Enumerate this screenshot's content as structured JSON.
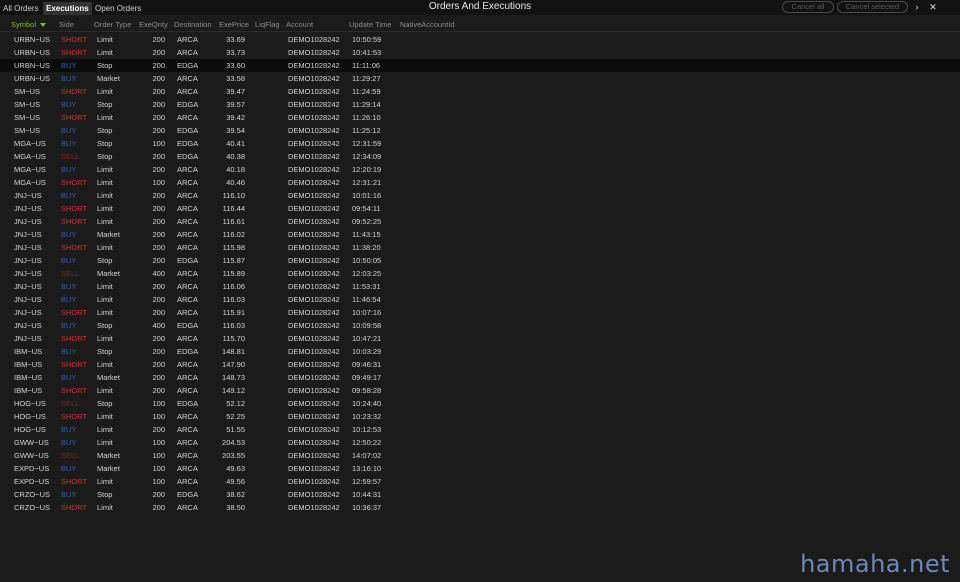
{
  "window": {
    "title": "Orders And Executions"
  },
  "tabs": [
    {
      "label": "All Orders",
      "active": false
    },
    {
      "label": "Executions",
      "active": true
    },
    {
      "label": "Open Orders",
      "active": false
    }
  ],
  "toolbar": {
    "cancel_all_label": "Cancel all",
    "cancel_selected_label": "Cancel selected",
    "expand_icon": "chevron-right-icon",
    "close_icon": "close-icon"
  },
  "columns": {
    "symbol": "Symbol",
    "side": "Side",
    "order_type": "Order Type",
    "exe_qnty": "ExeQnty",
    "destination": "Destination",
    "exe_price": "ExePrice",
    "liq_flag": "LiqFlag",
    "account": "Account",
    "update_time": "Update Time",
    "native_account_id": "NativeAccountId"
  },
  "sorted_column": "symbol",
  "colors": {
    "short": "#d23030",
    "buy": "#2f5fa8",
    "sell": "#8a2222",
    "accent": "#7fbf2a"
  },
  "rows": [
    {
      "symbol": "URBN~US",
      "side": "SHORT",
      "type": "Limit",
      "qty": "200",
      "dest": "ARCA",
      "price": "33.69",
      "account": "DEMO1028242",
      "time": "10:50:59"
    },
    {
      "symbol": "URBN~US",
      "side": "SHORT",
      "type": "Limit",
      "qty": "200",
      "dest": "ARCA",
      "price": "33.73",
      "account": "DEMO1028242",
      "time": "10:41:53"
    },
    {
      "symbol": "URBN~US",
      "side": "BUY",
      "type": "Stop",
      "qty": "200",
      "dest": "EDGA",
      "price": "33.60",
      "account": "DEMO1028242",
      "time": "11:11:06",
      "selected": true
    },
    {
      "symbol": "URBN~US",
      "side": "BUY",
      "type": "Market",
      "qty": "200",
      "dest": "ARCA",
      "price": "33.58",
      "account": "DEMO1028242",
      "time": "11:29:27"
    },
    {
      "symbol": "SM~US",
      "side": "SHORT",
      "type": "Limit",
      "qty": "200",
      "dest": "ARCA",
      "price": "39.47",
      "account": "DEMO1028242",
      "time": "11:24:59"
    },
    {
      "symbol": "SM~US",
      "side": "BUY",
      "type": "Stop",
      "qty": "200",
      "dest": "EDGA",
      "price": "39.57",
      "account": "DEMO1028242",
      "time": "11:29:14"
    },
    {
      "symbol": "SM~US",
      "side": "SHORT",
      "type": "Limit",
      "qty": "200",
      "dest": "ARCA",
      "price": "39.42",
      "account": "DEMO1028242",
      "time": "11:26:10"
    },
    {
      "symbol": "SM~US",
      "side": "BUY",
      "type": "Stop",
      "qty": "200",
      "dest": "EDGA",
      "price": "39.54",
      "account": "DEMO1028242",
      "time": "11:25:12"
    },
    {
      "symbol": "MGA~US",
      "side": "BUY",
      "type": "Stop",
      "qty": "100",
      "dest": "EDGA",
      "price": "40.41",
      "account": "DEMO1028242",
      "time": "12:31:59"
    },
    {
      "symbol": "MGA~US",
      "side": "SELL",
      "type": "Stop",
      "qty": "200",
      "dest": "EDGA",
      "price": "40.38",
      "account": "DEMO1028242",
      "time": "12:34:09"
    },
    {
      "symbol": "MGA~US",
      "side": "BUY",
      "type": "Limit",
      "qty": "200",
      "dest": "ARCA",
      "price": "40.18",
      "account": "DEMO1028242",
      "time": "12:20:19"
    },
    {
      "symbol": "MGA~US",
      "side": "SHORT",
      "type": "Limit",
      "qty": "100",
      "dest": "ARCA",
      "price": "40.46",
      "account": "DEMO1028242",
      "time": "12:31:21"
    },
    {
      "symbol": "JNJ~US",
      "side": "BUY",
      "type": "Limit",
      "qty": "200",
      "dest": "ARCA",
      "price": "116.10",
      "account": "DEMO1028242",
      "time": "10:01:16"
    },
    {
      "symbol": "JNJ~US",
      "side": "SHORT",
      "type": "Limit",
      "qty": "200",
      "dest": "ARCA",
      "price": "116.44",
      "account": "DEMO1028242",
      "time": "09:54:11"
    },
    {
      "symbol": "JNJ~US",
      "side": "SHORT",
      "type": "Limit",
      "qty": "200",
      "dest": "ARCA",
      "price": "116.61",
      "account": "DEMO1028242",
      "time": "09:52:25"
    },
    {
      "symbol": "JNJ~US",
      "side": "BUY",
      "type": "Market",
      "qty": "200",
      "dest": "ARCA",
      "price": "116.02",
      "account": "DEMO1028242",
      "time": "11:43:15"
    },
    {
      "symbol": "JNJ~US",
      "side": "SHORT",
      "type": "Limit",
      "qty": "200",
      "dest": "ARCA",
      "price": "115.98",
      "account": "DEMO1028242",
      "time": "11:38:20"
    },
    {
      "symbol": "JNJ~US",
      "side": "BUY",
      "type": "Stop",
      "qty": "200",
      "dest": "EDGA",
      "price": "115.87",
      "account": "DEMO1028242",
      "time": "10:50:05"
    },
    {
      "symbol": "JNJ~US",
      "side": "SELL",
      "type": "Market",
      "qty": "400",
      "dest": "ARCA",
      "price": "115.89",
      "account": "DEMO1028242",
      "time": "12:03:25"
    },
    {
      "symbol": "JNJ~US",
      "side": "BUY",
      "type": "Limit",
      "qty": "200",
      "dest": "ARCA",
      "price": "116.06",
      "account": "DEMO1028242",
      "time": "11:53:31"
    },
    {
      "symbol": "JNJ~US",
      "side": "BUY",
      "type": "Limit",
      "qty": "200",
      "dest": "ARCA",
      "price": "116.03",
      "account": "DEMO1028242",
      "time": "11:46:54"
    },
    {
      "symbol": "JNJ~US",
      "side": "SHORT",
      "type": "Limit",
      "qty": "200",
      "dest": "ARCA",
      "price": "115.91",
      "account": "DEMO1028242",
      "time": "10:07:16"
    },
    {
      "symbol": "JNJ~US",
      "side": "BUY",
      "type": "Stop",
      "qty": "400",
      "dest": "EDGA",
      "price": "116.03",
      "account": "DEMO1028242",
      "time": "10:09:58"
    },
    {
      "symbol": "JNJ~US",
      "side": "SHORT",
      "type": "Limit",
      "qty": "200",
      "dest": "ARCA",
      "price": "115.70",
      "account": "DEMO1028242",
      "time": "10:47:21"
    },
    {
      "symbol": "IBM~US",
      "side": "BUY",
      "type": "Stop",
      "qty": "200",
      "dest": "EDGA",
      "price": "148.81",
      "account": "DEMO1028242",
      "time": "10:03:29"
    },
    {
      "symbol": "IBM~US",
      "side": "SHORT",
      "type": "Limit",
      "qty": "200",
      "dest": "ARCA",
      "price": "147.90",
      "account": "DEMO1028242",
      "time": "09:46:31"
    },
    {
      "symbol": "IBM~US",
      "side": "BUY",
      "type": "Market",
      "qty": "200",
      "dest": "ARCA",
      "price": "148.73",
      "account": "DEMO1028242",
      "time": "09:49:17"
    },
    {
      "symbol": "IBM~US",
      "side": "SHORT",
      "type": "Limit",
      "qty": "200",
      "dest": "ARCA",
      "price": "149.12",
      "account": "DEMO1028242",
      "time": "09:58:28"
    },
    {
      "symbol": "HOG~US",
      "side": "SELL",
      "type": "Stop",
      "qty": "100",
      "dest": "EDGA",
      "price": "52.12",
      "account": "DEMO1028242",
      "time": "10:24:40"
    },
    {
      "symbol": "HOG~US",
      "side": "SHORT",
      "type": "Limit",
      "qty": "100",
      "dest": "ARCA",
      "price": "52.25",
      "account": "DEMO1028242",
      "time": "10:23:32"
    },
    {
      "symbol": "HOG~US",
      "side": "BUY",
      "type": "Limit",
      "qty": "200",
      "dest": "ARCA",
      "price": "51.55",
      "account": "DEMO1028242",
      "time": "10:12:53"
    },
    {
      "symbol": "GWW~US",
      "side": "BUY",
      "type": "Limit",
      "qty": "100",
      "dest": "ARCA",
      "price": "204.53",
      "account": "DEMO1028242",
      "time": "12:50:22"
    },
    {
      "symbol": "GWW~US",
      "side": "SELL",
      "type": "Market",
      "qty": "100",
      "dest": "ARCA",
      "price": "203.55",
      "account": "DEMO1028242",
      "time": "14:07:02"
    },
    {
      "symbol": "EXPD~US",
      "side": "BUY",
      "type": "Market",
      "qty": "100",
      "dest": "ARCA",
      "price": "49.63",
      "account": "DEMO1028242",
      "time": "13:16:10"
    },
    {
      "symbol": "EXPD~US",
      "side": "SHORT",
      "type": "Limit",
      "qty": "100",
      "dest": "ARCA",
      "price": "49.56",
      "account": "DEMO1028242",
      "time": "12:59:57"
    },
    {
      "symbol": "CRZO~US",
      "side": "BUY",
      "type": "Stop",
      "qty": "200",
      "dest": "EDGA",
      "price": "38.62",
      "account": "DEMO1028242",
      "time": "10:44:31"
    },
    {
      "symbol": "CRZO~US",
      "side": "SHORT",
      "type": "Limit",
      "qty": "200",
      "dest": "ARCA",
      "price": "38.50",
      "account": "DEMO1028242",
      "time": "10:36:37"
    }
  ],
  "watermark": "hamaha.net"
}
